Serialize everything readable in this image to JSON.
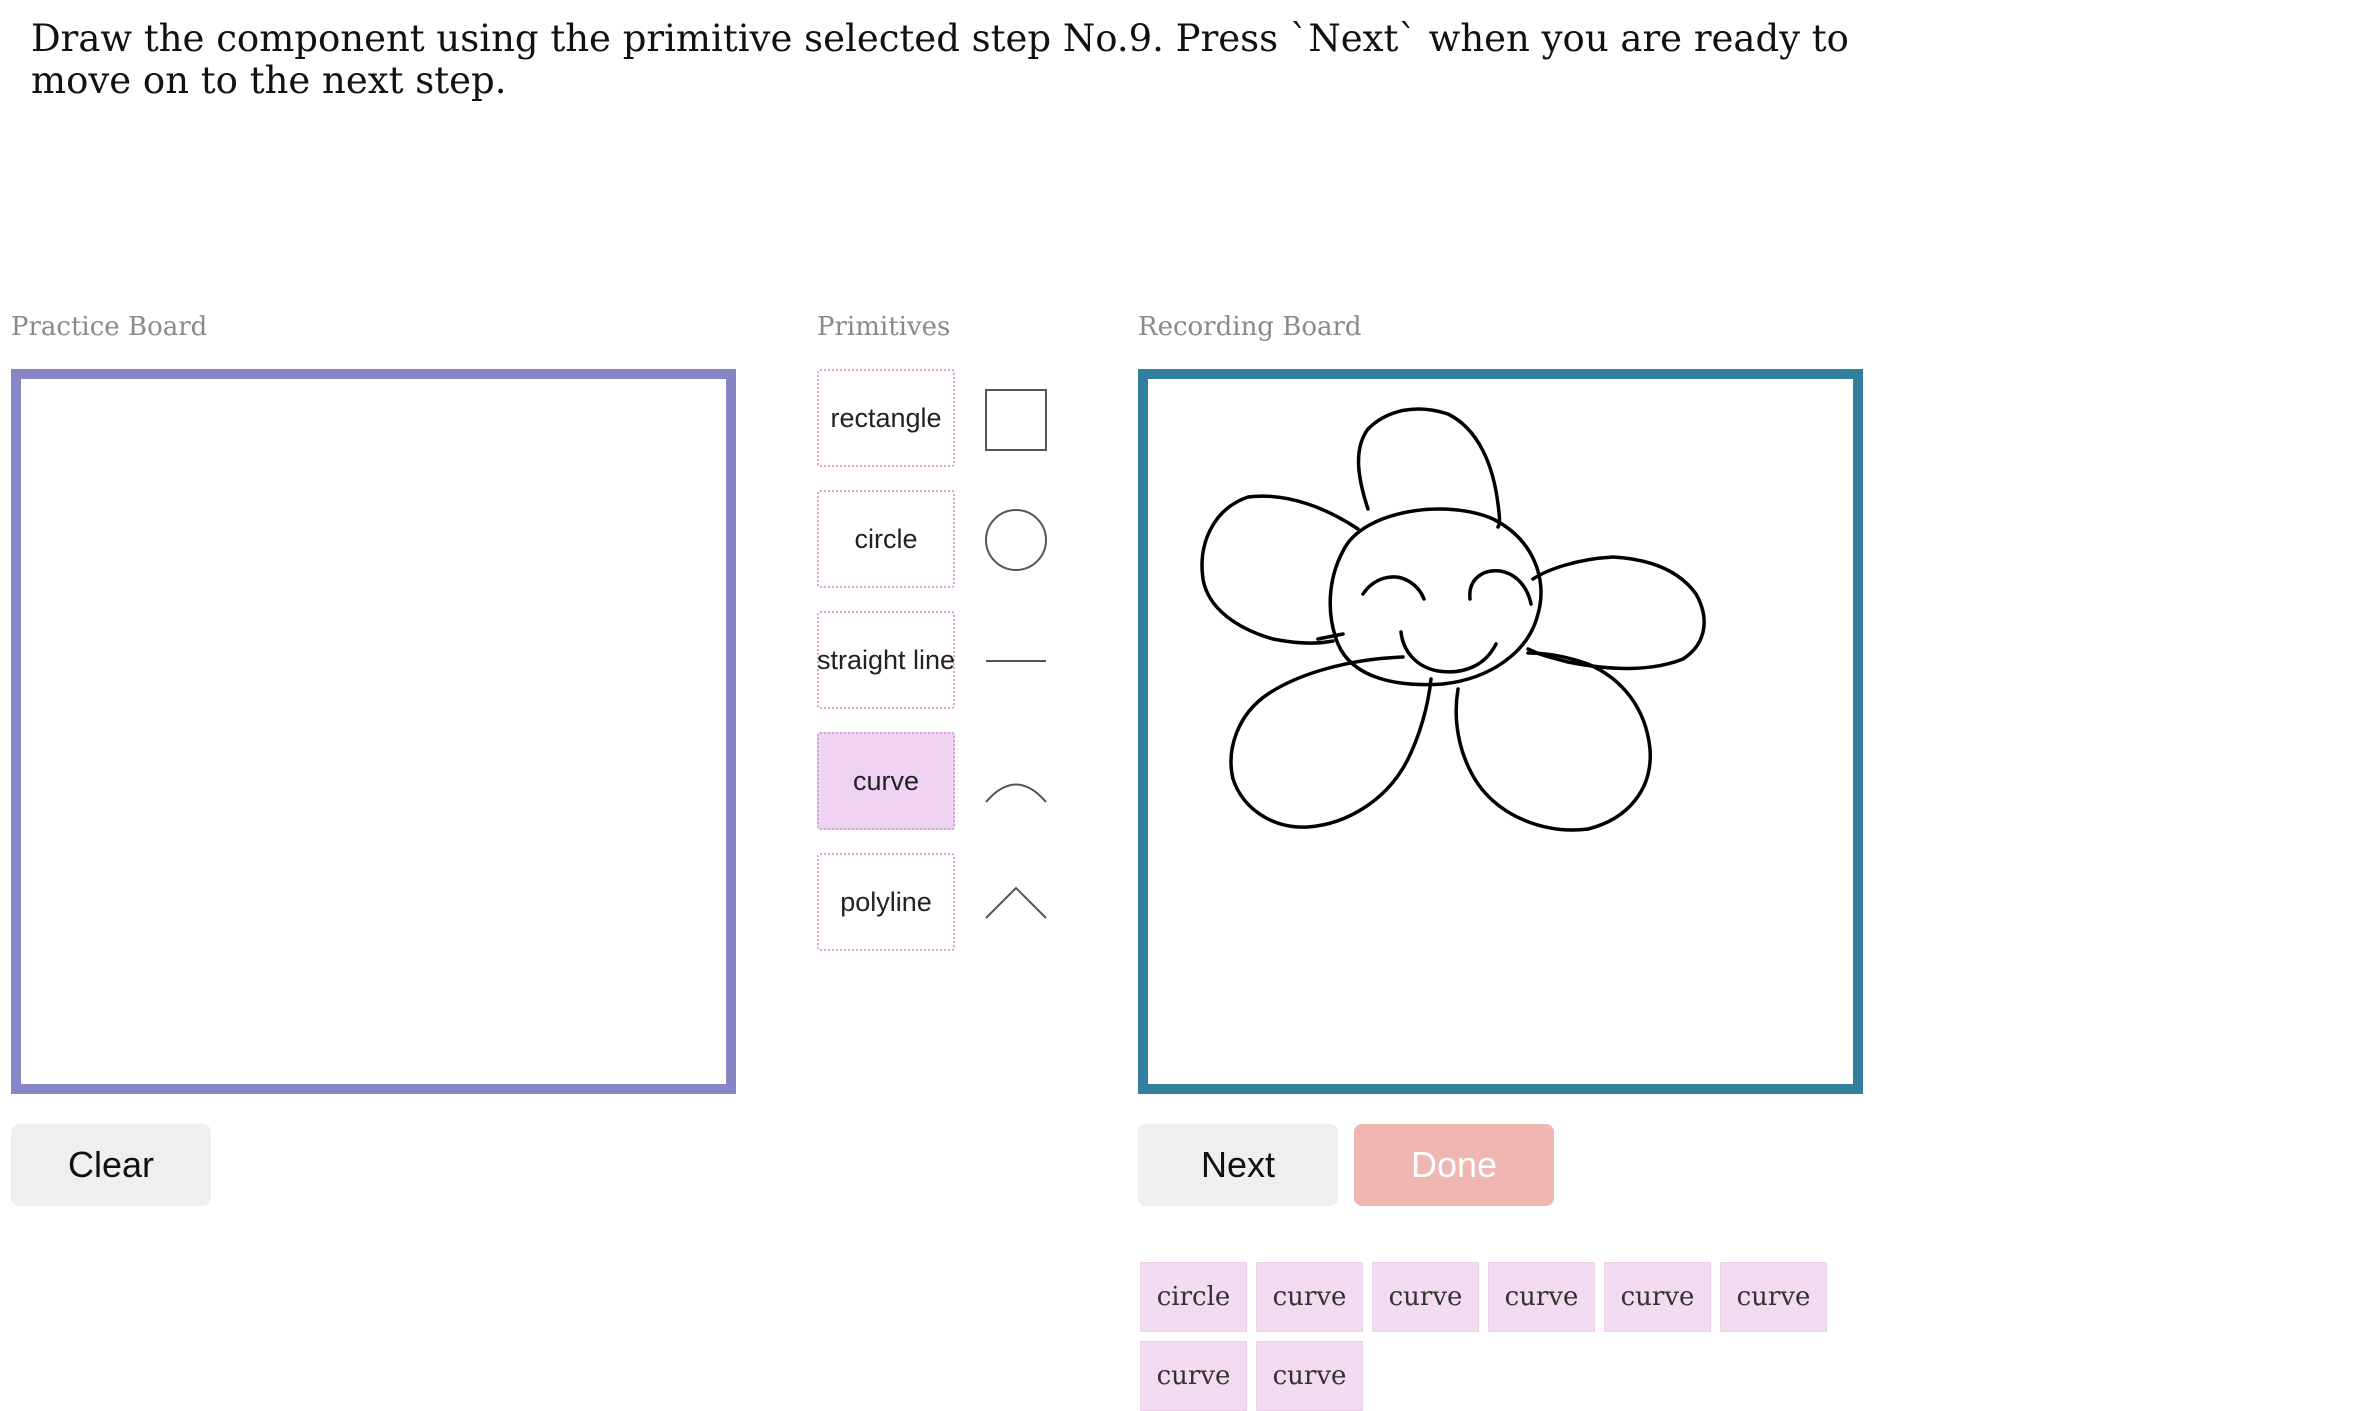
{
  "instruction": "Draw the component using the primitive selected step No.9. Press `Next` when you are ready to move on to the next step.",
  "practice_board": {
    "label": "Practice Board"
  },
  "primitives": {
    "label": "Primitives",
    "items": [
      {
        "label": "rectangle",
        "icon": "rectangle-icon",
        "selected": false
      },
      {
        "label": "circle",
        "icon": "circle-icon",
        "selected": false
      },
      {
        "label": "straight line",
        "icon": "straight-line-icon",
        "selected": false
      },
      {
        "label": "curve",
        "icon": "curve-icon",
        "selected": true
      },
      {
        "label": "polyline",
        "icon": "polyline-icon",
        "selected": false
      }
    ],
    "selected_color": "#f0d3f3"
  },
  "recording_board": {
    "label": "Recording Board"
  },
  "buttons": {
    "clear": "Clear",
    "next": "Next",
    "done": "Done"
  },
  "history": [
    "circle",
    "curve",
    "curve",
    "curve",
    "curve",
    "curve",
    "curve",
    "curve"
  ],
  "colors": {
    "practice_border": "#8585c7",
    "recording_border": "#337f9e",
    "done_button": "#f0b6b2",
    "chip": "#f3dcf1"
  }
}
